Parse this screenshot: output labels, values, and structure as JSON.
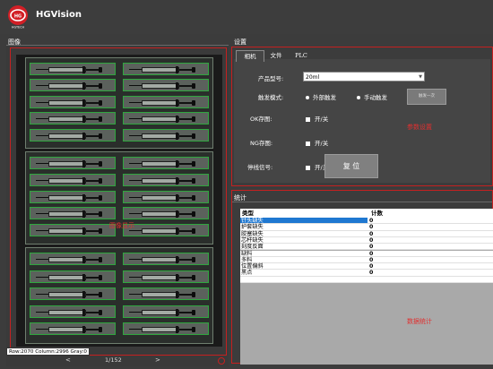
{
  "app": {
    "title": "HGVision",
    "logo_text": "HGTECH"
  },
  "image_panel": {
    "title": "图像",
    "overlay_label": "图像显示",
    "status_readout": "Row:2070  Column:2996  Gray:0",
    "pager": {
      "prev": "<",
      "next": ">",
      "indicator": "1/152"
    }
  },
  "settings": {
    "title": "设置",
    "tabs": [
      "相机",
      "文件",
      "PLC"
    ],
    "product_label": "产品型号:",
    "product_value": "20ml",
    "trigger_label": "触发模式:",
    "trigger_options": [
      "外部触发",
      "手动触发"
    ],
    "trigger_once_button": "触发一次",
    "ok_label": "OK存图:",
    "ok_toggle": "开/关",
    "ng_label": "NG存图:",
    "ng_toggle": "开/关",
    "stop_label": "停线信号:",
    "stop_toggle": "开/关",
    "reset_button": "复 位",
    "overlay_label": "参数设置"
  },
  "stats": {
    "title": "统计",
    "columns": [
      "类型",
      "计数"
    ],
    "rows": [
      {
        "type": "针头缺失",
        "count": "0",
        "selected": true
      },
      {
        "type": "护套缺失",
        "count": "0",
        "selected": false
      },
      {
        "type": "胶塞缺失",
        "count": "0",
        "selected": false
      },
      {
        "type": "芯杆缺失",
        "count": "0",
        "selected": false
      },
      {
        "type": "刻度反面",
        "count": "0",
        "selected": false
      },
      {
        "type": "缺料",
        "count": "0",
        "selected": false
      },
      {
        "type": "多料",
        "count": "0",
        "selected": false
      },
      {
        "type": "位置偏斜",
        "count": "0",
        "selected": false
      },
      {
        "type": "黑点",
        "count": "0",
        "selected": false
      },
      {
        "type": "",
        "count": "",
        "selected": false
      }
    ],
    "overlay_label": "数据统计"
  },
  "colors": {
    "accent_red": "#c52020",
    "selection_blue": "#1f78d1",
    "detect_green": "#2fa63e"
  }
}
